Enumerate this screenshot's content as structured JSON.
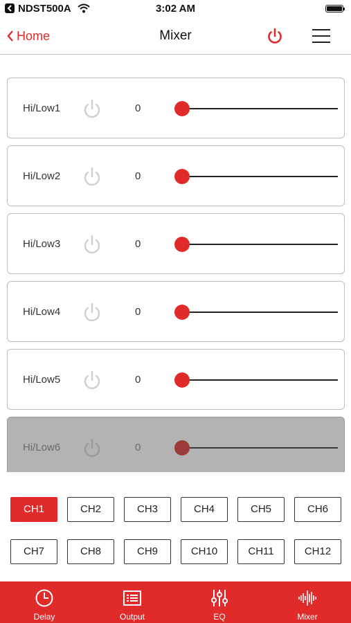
{
  "status_bar": {
    "carrier": "NDST500A",
    "time": "3:02 AM"
  },
  "nav": {
    "back_label": "Home",
    "title": "Mixer"
  },
  "mixer": {
    "rows": [
      {
        "label": "Hi/Low1",
        "value": "0",
        "slider_fraction": 0,
        "disabled": false
      },
      {
        "label": "Hi/Low2",
        "value": "0",
        "slider_fraction": 0,
        "disabled": false
      },
      {
        "label": "Hi/Low3",
        "value": "0",
        "slider_fraction": 0,
        "disabled": false
      },
      {
        "label": "Hi/Low4",
        "value": "0",
        "slider_fraction": 0,
        "disabled": false
      },
      {
        "label": "Hi/Low5",
        "value": "0",
        "slider_fraction": 0,
        "disabled": false
      },
      {
        "label": "Hi/Low6",
        "value": "0",
        "slider_fraction": 0,
        "disabled": true
      }
    ]
  },
  "channels": {
    "selected": "CH1",
    "buttons": [
      "CH1",
      "CH2",
      "CH3",
      "CH4",
      "CH5",
      "CH6",
      "CH7",
      "CH8",
      "CH9",
      "CH10",
      "CH11",
      "CH12"
    ]
  },
  "tabs": [
    {
      "label": "Delay",
      "icon": "clock-icon"
    },
    {
      "label": "Output",
      "icon": "list-icon"
    },
    {
      "label": "EQ",
      "icon": "equalizer-icon"
    },
    {
      "label": "Mixer",
      "icon": "waveform-icon"
    }
  ],
  "colors": {
    "accent": "#e12b2b",
    "power_icon_inactive": "#cfcfcf"
  }
}
